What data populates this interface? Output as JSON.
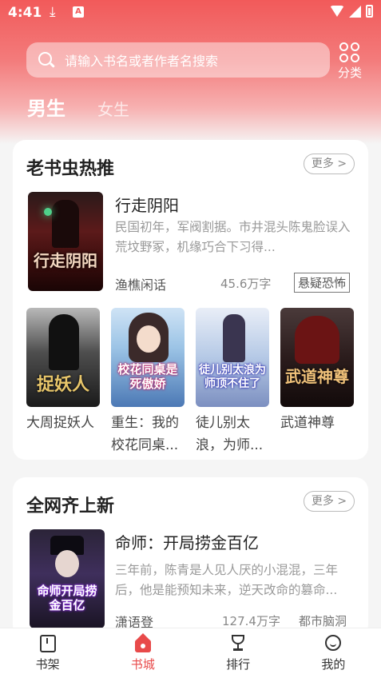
{
  "status_bar": {
    "time": "4:41",
    "download_icon": "download-icon",
    "app_badge_letter": "A"
  },
  "search": {
    "placeholder": "请输入书名或者作者名搜索"
  },
  "category": {
    "label": "分类"
  },
  "gender_tabs": [
    {
      "label": "男生",
      "selected": true
    },
    {
      "label": "女生",
      "selected": false
    }
  ],
  "section_hot": {
    "title": "老书虫热推",
    "more_label": "更多 >",
    "featured": {
      "title": "行走阴阳",
      "description": "民国初年，军阀割据。市井混头陈鬼脸误入荒坟野冢，机缘巧合下习得...",
      "author": "渔樵闲话",
      "word_count": "45.6万字",
      "genre": "悬疑恐怖",
      "cover_text": "行走阴阳"
    },
    "books": [
      {
        "title": "大周捉妖人",
        "cover_text": "捉妖人"
      },
      {
        "title": "重生：我的校花同桌...",
        "cover_text": "校花同桌是死傲娇"
      },
      {
        "title": "徒儿别太浪，为师...",
        "cover_text": "徒儿别太浪为师顶不住了"
      },
      {
        "title": "武道神尊",
        "cover_text": "武道神尊"
      }
    ]
  },
  "section_new": {
    "title": "全网齐上新",
    "more_label": "更多 >",
    "featured": {
      "title": "命师：开局捞金百亿",
      "description": "三年前，陈青是人见人厌的小混混，三年后，他是能预知未来，逆天改命的篡命...",
      "author": "潇语登",
      "word_count": "127.4万字",
      "genre": "都市脑洞",
      "cover_text": "命师开局捞金百亿"
    }
  },
  "bottom_nav": [
    {
      "label": "书架",
      "icon": "bookshelf-icon",
      "active": false
    },
    {
      "label": "书城",
      "icon": "bookstore-icon",
      "active": true
    },
    {
      "label": "排行",
      "icon": "trophy-icon",
      "active": false
    },
    {
      "label": "我的",
      "icon": "profile-icon",
      "active": false
    }
  ],
  "colors": {
    "accent": "#e84a4a",
    "header_gradient_top": "#f25a5a"
  }
}
